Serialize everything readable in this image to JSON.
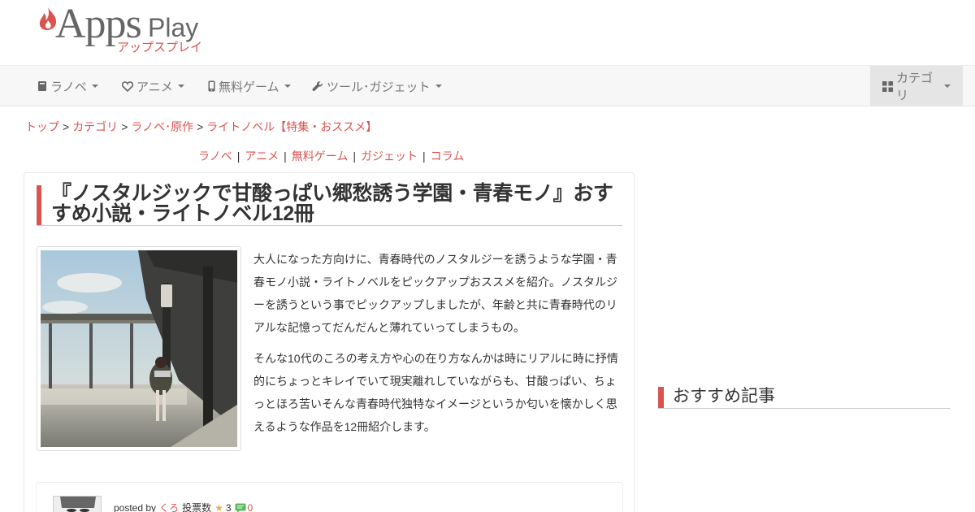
{
  "logo": {
    "brand": "Apps",
    "play": "Play",
    "kana": "アップスプレイ"
  },
  "nav": {
    "items": [
      {
        "label": "ラノベ",
        "icon": "book-icon"
      },
      {
        "label": "アニメ",
        "icon": "heart-icon"
      },
      {
        "label": "無料ゲーム",
        "icon": "mobile-icon"
      },
      {
        "label": "ツール･ガジェット",
        "icon": "wrench-icon"
      }
    ],
    "category": {
      "label": "カテゴリ",
      "icon": "grid-icon"
    }
  },
  "breadcrumb": {
    "items": [
      "トップ",
      "カテゴリ",
      "ラノベ･原作",
      "ライトノベル【特集・おススメ】"
    ],
    "separator": ">"
  },
  "subnav": {
    "items": [
      "ラノベ",
      "アニメ",
      "無料ゲーム",
      "ガジェット",
      "コラム"
    ],
    "separator": "|"
  },
  "article": {
    "title": "『ノスタルジックで甘酸っぱい郷愁誘う学園・青春モノ』おすすめ小説・ライトノベル12冊",
    "paragraphs": [
      "大人になった方向けに、青春時代のノスタルジーを誘うような学園・青春モノ小説・ライトノベルをピックアップおススメを紹介。ノスタルジーを誘うという事でピックアップしましたが、年齢と共に青春時代のリアルな記憶ってだんだんと薄れていってしまうもの。",
      "そんな10代のころの考え方や心の在り方なんかは時にリアルに時に抒情的にちょっとキレイでいて現実離れしていながらも、甘酸っぱい、ちょっとほろ苦いそんな青春時代独特なイメージというか匂いを懐かしく思えるような作品を12冊紹介します。"
    ],
    "meta": {
      "posted_by": "posted by",
      "author": "くろ",
      "votes_label": "投票数",
      "star": "★",
      "votes": "3",
      "comments": "0"
    }
  },
  "sidebar": {
    "heading": "おすすめ記事"
  },
  "colors": {
    "accent": "#d9534f",
    "navbar_bg": "#f7f7f7"
  }
}
